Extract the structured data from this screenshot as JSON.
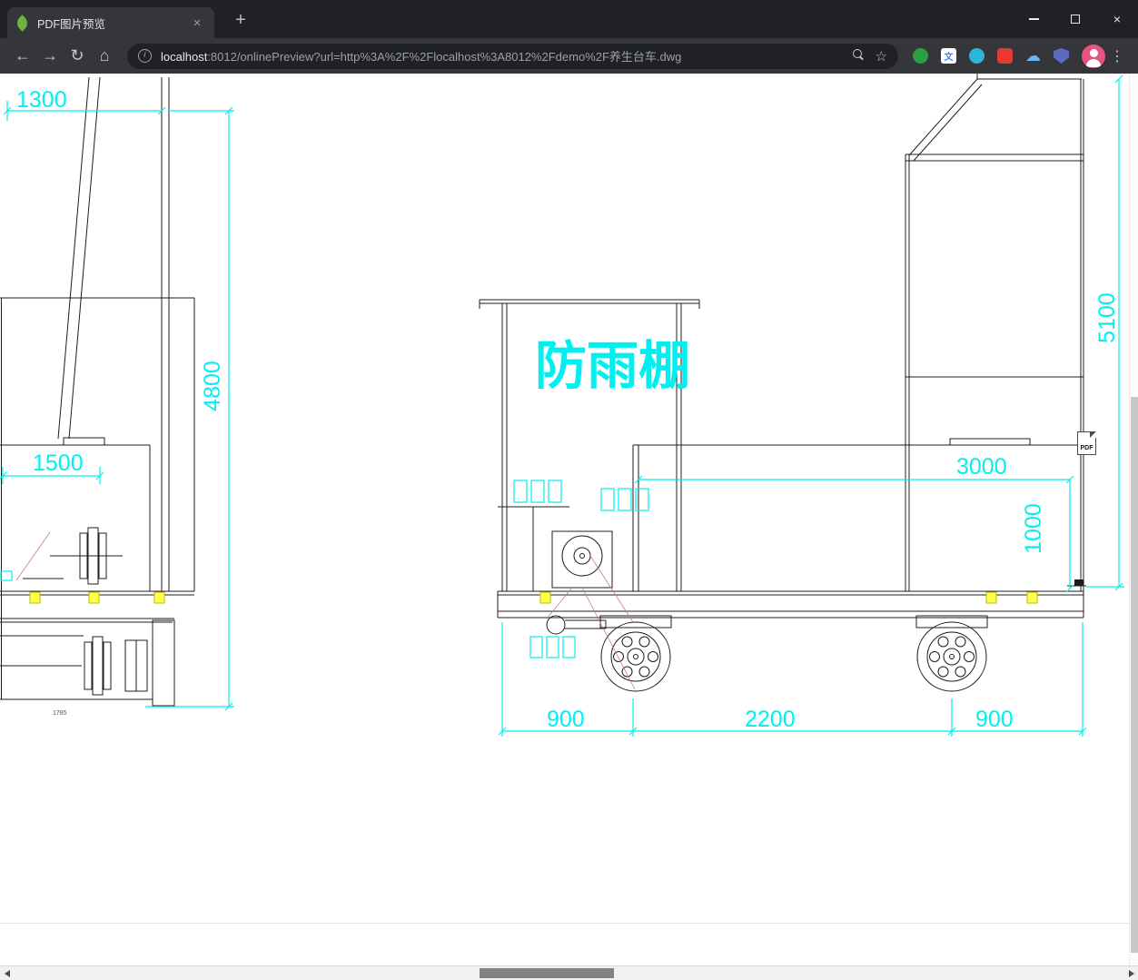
{
  "colors": {
    "dimension_cyan": "#00EFEF",
    "highlight_yellow": "#FFFF4D",
    "construction_pink": "#C9788C",
    "spring_leaf_green": "#6DB33F"
  },
  "window": {
    "tab_title": "PDF图片预览"
  },
  "icons": {
    "new_tab": "+",
    "tab_close": "×",
    "window_close": "×",
    "back": "←",
    "forward": "→",
    "reload": "↻",
    "home": "⌂",
    "info": "i",
    "star": "☆",
    "menu": "⋮",
    "translate_glyph": "文",
    "cloud_glyph": "☁"
  },
  "address": {
    "host": "localhost",
    "rest": ":8012/onlinePreview?url=http%3A%2F%2Flocalhost%3A8012%2Fdemo%2F养生台车.dwg"
  },
  "drawing": {
    "shelter": "防雨棚",
    "d1300": "1300",
    "d4800": "4800",
    "d1500": "1500",
    "d5100": "5100",
    "d3000": "3000",
    "d1000": "1000",
    "d900a": "900",
    "d2200": "2200",
    "d900b": "900",
    "dsmall": "1785",
    "pdf_badge": "PDF"
  }
}
